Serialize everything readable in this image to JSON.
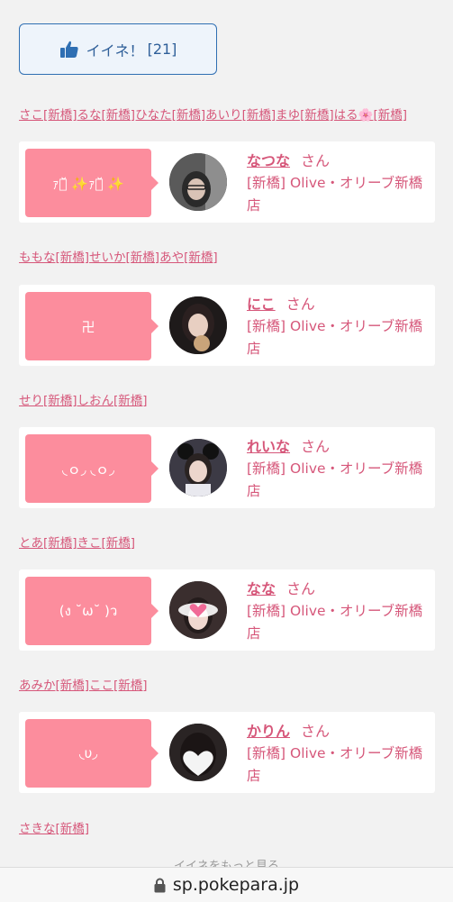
{
  "like_button": {
    "label": "イイネ！",
    "count": "[21]"
  },
  "name_lines": [
    "さこ[新橋]るな[新橋]ひなた[新橋]あいり[新橋]まゆ[新橋]はる🌸[新橋]",
    "ももな[新橋]せいか[新橋]あや[新橋]",
    "せり[新橋]しおん[新橋]",
    "とあ[新橋]きこ[新橋]",
    "あみか[新橋]ここ[新橋]",
    "さきな[新橋]"
  ],
  "cards": [
    {
      "bubble": "ｧﾁ̆ ✨ｧﾁ̆ ✨",
      "name": "なつな",
      "honorific": "さん",
      "shop": "[新橋] Olive・オリーブ新橋店"
    },
    {
      "bubble": "卍",
      "name": "にこ",
      "honorific": "さん",
      "shop": "[新橋] Olive・オリーブ新橋店"
    },
    {
      "bubble": "◟ｏ◞ ◟ｏ◞",
      "name": "れいな",
      "honorific": "さん",
      "shop": "[新橋] Olive・オリーブ新橋店"
    },
    {
      "bubble": "(ง ˘ω˘ )ว",
      "name": "なな",
      "honorific": "さん",
      "shop": "[新橋] Olive・オリーブ新橋店"
    },
    {
      "bubble": "◟υ◞",
      "name": "かりん",
      "honorific": "さん",
      "shop": "[新橋] Olive・オリーブ新橋店"
    }
  ],
  "more_link": "イイネをもっと見る",
  "url_bar": {
    "url": "sp.pokepara.jp"
  },
  "colors": {
    "accent": "#d6577a",
    "bubble": "#fc8d9d",
    "button_border": "#2f6fb3"
  }
}
